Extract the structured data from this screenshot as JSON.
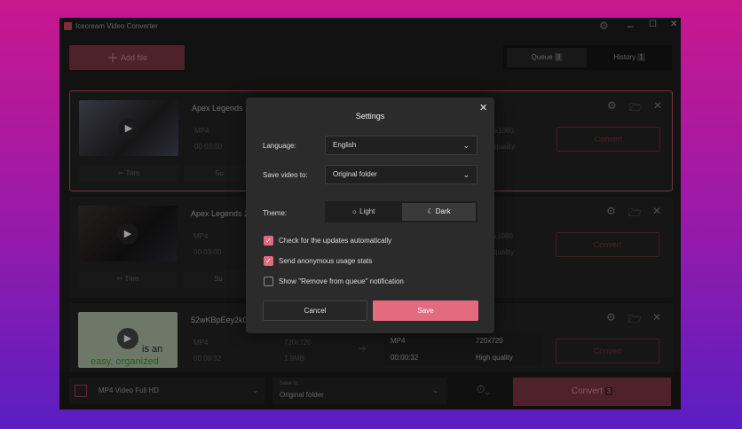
{
  "app": {
    "title": "Icecream Video Converter"
  },
  "toolbar": {
    "add_file": "Add file",
    "queue_label": "Queue",
    "queue_count": "3",
    "history_label": "History",
    "history_count": "1"
  },
  "items": [
    {
      "name": "Apex Legends 2",
      "in_format": "MP4",
      "in_duration": "00:03:00",
      "out_resolution": "x1080",
      "out_quality": "quality",
      "trim": "Trim",
      "subtitles": "Su",
      "convert": "Convert"
    },
    {
      "name": "Apex Legends 2",
      "in_format": "MP4",
      "in_duration": "00:03:00",
      "out_resolution": "x1080",
      "out_quality": "quality",
      "trim": "Trim",
      "subtitles": "Su",
      "convert": "Convert"
    },
    {
      "name": "52wKBpEey2k0",
      "in_format": "MP4",
      "in_duration": "00:00:32",
      "in_resolution": "720x720",
      "in_size": "1.9MB",
      "out_format": "MP4",
      "out_duration": "00:00:32",
      "out_resolution": "720x720",
      "out_quality": "High quality",
      "convert": "Convert",
      "thumb_text_1": "is an",
      "thumb_text_2": "easy, organized"
    }
  ],
  "bottom": {
    "preset": "MP4 Video Full HD",
    "save_to_label": "Save to:",
    "save_to_value": "Original folder",
    "convert": "Convert",
    "convert_count": "3"
  },
  "settings": {
    "title": "Settings",
    "language_label": "Language:",
    "language_value": "English",
    "save_label": "Save video to:",
    "save_value": "Original folder",
    "theme_label": "Theme:",
    "theme_light": "Light",
    "theme_dark": "Dark",
    "options": [
      {
        "label": "Check for the updates automatically",
        "checked": true
      },
      {
        "label": "Send anonymous usage stats",
        "checked": true
      },
      {
        "label": "Show \"Remove from queue\" notification",
        "checked": false
      }
    ],
    "cancel": "Cancel",
    "save": "Save"
  },
  "colors": {
    "accent": "#e36b80",
    "bg": "#1c1c1c"
  }
}
